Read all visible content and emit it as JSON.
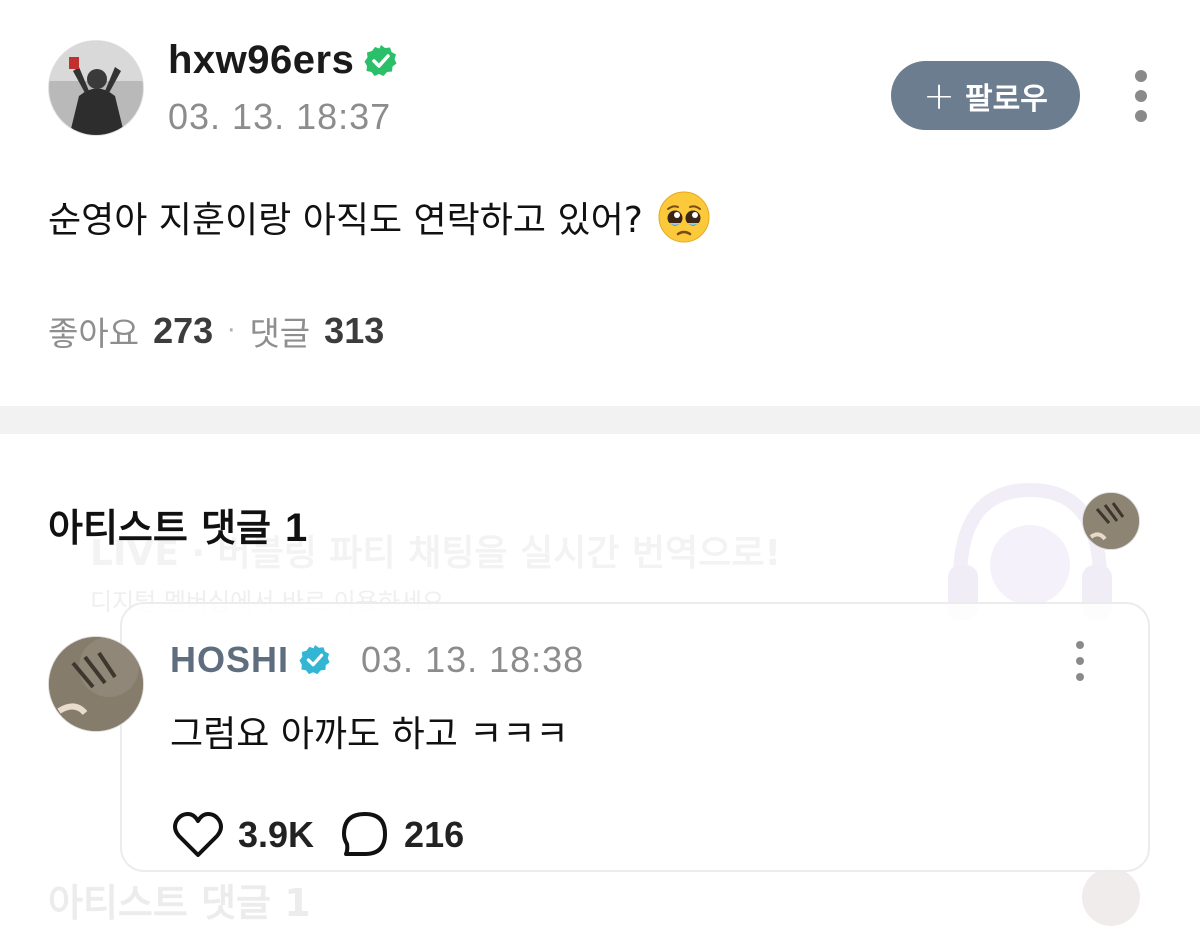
{
  "post": {
    "username": "hxw96ers",
    "timestamp": "03. 13. 18:37",
    "follow_label": "팔로우",
    "body": "순영아 지훈이랑 아직도 연락하고 있어?",
    "emoji": "pleading-face",
    "likes_label": "좋아요",
    "likes": "273",
    "comments_label": "댓글",
    "comments": "313"
  },
  "background_banner": {
    "title": "LIVE · 버블링 파티 채팅을 실시간 번역으로!",
    "subtitle": "디지털 멤버십에서 바로 이용하세요"
  },
  "artist_comments": {
    "section_title": "아티스트 댓글",
    "count": "1",
    "comment": {
      "author": "HOSHI",
      "timestamp": "03. 13. 18:38",
      "body": "그럼요 아까도 하고 ㅋㅋㅋ",
      "likes": "3.9K",
      "replies": "216"
    }
  },
  "colors": {
    "follow_button": "#6b7d8e",
    "verified_green": "#2bbf6a",
    "verified_blue": "#33b6d4",
    "artist_name": "#5f6e7e",
    "muted_text": "#8c8c8c"
  },
  "icons": [
    "verified-green-icon",
    "plus-icon",
    "more-vertical-icon",
    "pleading-face-emoji",
    "verified-blue-icon",
    "heart-icon",
    "speech-bubble-icon",
    "headphones-icon"
  ]
}
